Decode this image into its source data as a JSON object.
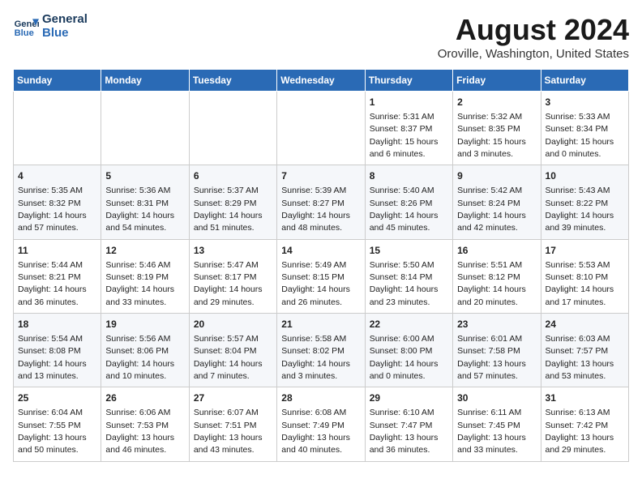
{
  "logo": {
    "line1": "General",
    "line2": "Blue"
  },
  "title": "August 2024",
  "subtitle": "Oroville, Washington, United States",
  "weekdays": [
    "Sunday",
    "Monday",
    "Tuesday",
    "Wednesday",
    "Thursday",
    "Friday",
    "Saturday"
  ],
  "weeks": [
    [
      {
        "day": "",
        "info": ""
      },
      {
        "day": "",
        "info": ""
      },
      {
        "day": "",
        "info": ""
      },
      {
        "day": "",
        "info": ""
      },
      {
        "day": "1",
        "info": "Sunrise: 5:31 AM\nSunset: 8:37 PM\nDaylight: 15 hours\nand 6 minutes."
      },
      {
        "day": "2",
        "info": "Sunrise: 5:32 AM\nSunset: 8:35 PM\nDaylight: 15 hours\nand 3 minutes."
      },
      {
        "day": "3",
        "info": "Sunrise: 5:33 AM\nSunset: 8:34 PM\nDaylight: 15 hours\nand 0 minutes."
      }
    ],
    [
      {
        "day": "4",
        "info": "Sunrise: 5:35 AM\nSunset: 8:32 PM\nDaylight: 14 hours\nand 57 minutes."
      },
      {
        "day": "5",
        "info": "Sunrise: 5:36 AM\nSunset: 8:31 PM\nDaylight: 14 hours\nand 54 minutes."
      },
      {
        "day": "6",
        "info": "Sunrise: 5:37 AM\nSunset: 8:29 PM\nDaylight: 14 hours\nand 51 minutes."
      },
      {
        "day": "7",
        "info": "Sunrise: 5:39 AM\nSunset: 8:27 PM\nDaylight: 14 hours\nand 48 minutes."
      },
      {
        "day": "8",
        "info": "Sunrise: 5:40 AM\nSunset: 8:26 PM\nDaylight: 14 hours\nand 45 minutes."
      },
      {
        "day": "9",
        "info": "Sunrise: 5:42 AM\nSunset: 8:24 PM\nDaylight: 14 hours\nand 42 minutes."
      },
      {
        "day": "10",
        "info": "Sunrise: 5:43 AM\nSunset: 8:22 PM\nDaylight: 14 hours\nand 39 minutes."
      }
    ],
    [
      {
        "day": "11",
        "info": "Sunrise: 5:44 AM\nSunset: 8:21 PM\nDaylight: 14 hours\nand 36 minutes."
      },
      {
        "day": "12",
        "info": "Sunrise: 5:46 AM\nSunset: 8:19 PM\nDaylight: 14 hours\nand 33 minutes."
      },
      {
        "day": "13",
        "info": "Sunrise: 5:47 AM\nSunset: 8:17 PM\nDaylight: 14 hours\nand 29 minutes."
      },
      {
        "day": "14",
        "info": "Sunrise: 5:49 AM\nSunset: 8:15 PM\nDaylight: 14 hours\nand 26 minutes."
      },
      {
        "day": "15",
        "info": "Sunrise: 5:50 AM\nSunset: 8:14 PM\nDaylight: 14 hours\nand 23 minutes."
      },
      {
        "day": "16",
        "info": "Sunrise: 5:51 AM\nSunset: 8:12 PM\nDaylight: 14 hours\nand 20 minutes."
      },
      {
        "day": "17",
        "info": "Sunrise: 5:53 AM\nSunset: 8:10 PM\nDaylight: 14 hours\nand 17 minutes."
      }
    ],
    [
      {
        "day": "18",
        "info": "Sunrise: 5:54 AM\nSunset: 8:08 PM\nDaylight: 14 hours\nand 13 minutes."
      },
      {
        "day": "19",
        "info": "Sunrise: 5:56 AM\nSunset: 8:06 PM\nDaylight: 14 hours\nand 10 minutes."
      },
      {
        "day": "20",
        "info": "Sunrise: 5:57 AM\nSunset: 8:04 PM\nDaylight: 14 hours\nand 7 minutes."
      },
      {
        "day": "21",
        "info": "Sunrise: 5:58 AM\nSunset: 8:02 PM\nDaylight: 14 hours\nand 3 minutes."
      },
      {
        "day": "22",
        "info": "Sunrise: 6:00 AM\nSunset: 8:00 PM\nDaylight: 14 hours\nand 0 minutes."
      },
      {
        "day": "23",
        "info": "Sunrise: 6:01 AM\nSunset: 7:58 PM\nDaylight: 13 hours\nand 57 minutes."
      },
      {
        "day": "24",
        "info": "Sunrise: 6:03 AM\nSunset: 7:57 PM\nDaylight: 13 hours\nand 53 minutes."
      }
    ],
    [
      {
        "day": "25",
        "info": "Sunrise: 6:04 AM\nSunset: 7:55 PM\nDaylight: 13 hours\nand 50 minutes."
      },
      {
        "day": "26",
        "info": "Sunrise: 6:06 AM\nSunset: 7:53 PM\nDaylight: 13 hours\nand 46 minutes."
      },
      {
        "day": "27",
        "info": "Sunrise: 6:07 AM\nSunset: 7:51 PM\nDaylight: 13 hours\nand 43 minutes."
      },
      {
        "day": "28",
        "info": "Sunrise: 6:08 AM\nSunset: 7:49 PM\nDaylight: 13 hours\nand 40 minutes."
      },
      {
        "day": "29",
        "info": "Sunrise: 6:10 AM\nSunset: 7:47 PM\nDaylight: 13 hours\nand 36 minutes."
      },
      {
        "day": "30",
        "info": "Sunrise: 6:11 AM\nSunset: 7:45 PM\nDaylight: 13 hours\nand 33 minutes."
      },
      {
        "day": "31",
        "info": "Sunrise: 6:13 AM\nSunset: 7:42 PM\nDaylight: 13 hours\nand 29 minutes."
      }
    ]
  ]
}
